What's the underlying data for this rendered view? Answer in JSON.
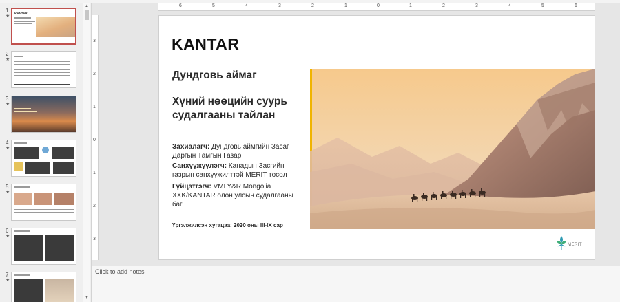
{
  "slide": {
    "logo": "KANTAR",
    "region": "Дундговь аймаг",
    "title_line1": "Хүний нөөцийн суурь",
    "title_line2": "судалгааны тайлан",
    "client_label": "Захиалагч:",
    "client_value_1": " Дундговь аймгийн Засаг",
    "client_value_2": "Даргын Тамгын Газар",
    "sponsor_label": "Санхүүжүүлэгч:",
    "sponsor_value_1": " Канадын Засгийн",
    "sponsor_value_2": "газрын санхүүжилттэй MERIT төсөл",
    "contractor_label": "Гүйцэтгэгч:",
    "contractor_value_1": " VMLY&R Mongolia",
    "contractor_value_2": "XXK/KANTAR олон улсын судалгааны",
    "contractor_value_3": "баг",
    "period": "Үргэлжилсэн хугацаа: 2020 оны III-IX сар",
    "merit_logo_text": "MERIT",
    "photo_icon": "desert-camel-caravan-image"
  },
  "notes": {
    "placeholder": "Click to add notes"
  },
  "thumbnails": [
    {
      "number": "1",
      "star": "★",
      "selected": true
    },
    {
      "number": "2",
      "star": "★",
      "selected": false
    },
    {
      "number": "3",
      "star": "★",
      "selected": false
    },
    {
      "number": "4",
      "star": "★",
      "selected": false
    },
    {
      "number": "5",
      "star": "★",
      "selected": false
    },
    {
      "number": "6",
      "star": "★",
      "selected": false
    },
    {
      "number": "7",
      "star": "★",
      "selected": false
    }
  ],
  "ruler": {
    "h_labels": [
      "6",
      "5",
      "4",
      "3",
      "2",
      "1",
      "0",
      "1",
      "2",
      "3",
      "4",
      "5",
      "6"
    ],
    "v_labels": [
      "3",
      "2",
      "1",
      "0",
      "1",
      "2",
      "3"
    ]
  },
  "colors": {
    "selected_border": "#c0504d",
    "accent_bar": "#f0b400"
  }
}
